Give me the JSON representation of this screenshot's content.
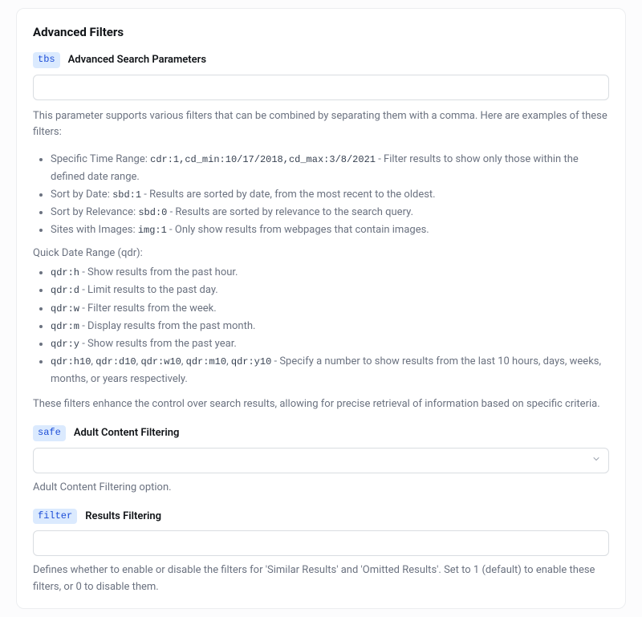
{
  "panel": {
    "title": "Advanced Filters"
  },
  "tbs": {
    "badge": "tbs",
    "label": "Advanced Search Parameters",
    "value": "",
    "intro": "This parameter supports various filters that can be combined by separating them with a comma. Here are examples of these filters:",
    "items": [
      {
        "pre": "Specific Time Range: ",
        "code": "cdr:1,cd_min:10/17/2018,cd_max:3/8/2021",
        "post": " - Filter results to show only those within the defined date range."
      },
      {
        "pre": "Sort by Date: ",
        "code": "sbd:1",
        "post": " - Results are sorted by date, from the most recent to the oldest."
      },
      {
        "pre": "Sort by Relevance: ",
        "code": "sbd:0",
        "post": " - Results are sorted by relevance to the search query."
      },
      {
        "pre": "Sites with Images: ",
        "code": "img:1",
        "post": " - Only show results from webpages that contain images."
      }
    ],
    "qdr_label": "Quick Date Range (qdr):",
    "qdr": [
      {
        "code": "qdr:h",
        "post": " - Show results from the past hour."
      },
      {
        "code": "qdr:d",
        "post": " - Limit results to the past day."
      },
      {
        "code": "qdr:w",
        "post": " - Filter results from the week."
      },
      {
        "code": "qdr:m",
        "post": " - Display results from the past month."
      },
      {
        "code": "qdr:y",
        "post": " - Show results from the past year."
      }
    ],
    "qdr_multi": {
      "codes": [
        "qdr:h10",
        "qdr:d10",
        "qdr:w10",
        "qdr:m10",
        "qdr:y10"
      ],
      "sep": ", ",
      "post": " - Specify a number to show results from the last 10 hours, days, weeks, months, or years respectively."
    },
    "footer": "These filters enhance the control over search results, allowing for precise retrieval of information based on specific criteria."
  },
  "safe": {
    "badge": "safe",
    "label": "Adult Content Filtering",
    "selected": "",
    "caption": "Adult Content Filtering option."
  },
  "filter": {
    "badge": "filter",
    "label": "Results Filtering",
    "value": "",
    "caption": "Defines whether to enable or disable the filters for 'Similar Results' and 'Omitted Results'. Set to 1 (default) to enable these filters, or 0 to disable them."
  }
}
